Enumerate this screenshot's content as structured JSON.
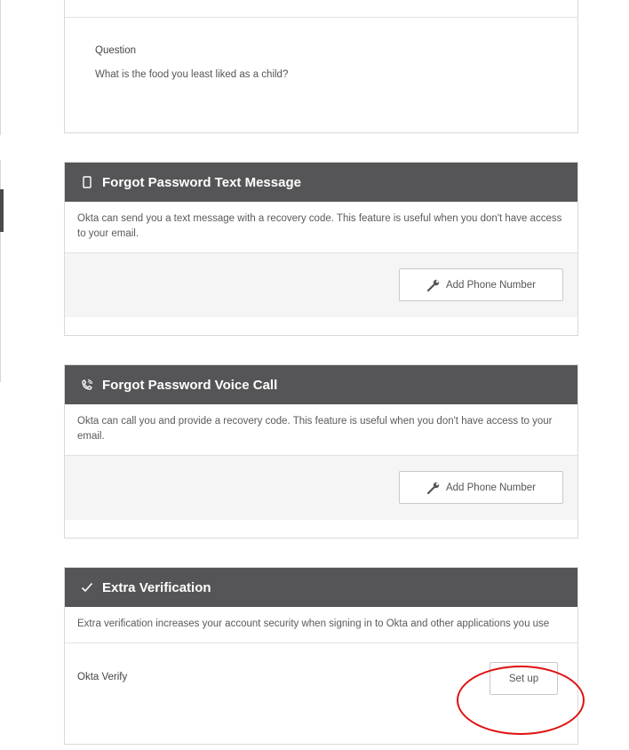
{
  "question_card": {
    "label": "Question",
    "question": "What is the food you least liked as a child?"
  },
  "sms_card": {
    "icon": "mobile-phone-icon",
    "title": "Forgot Password Text Message",
    "description": "Okta can send you a text message with a recovery code. This feature is useful when you don't have access to your email.",
    "button_label": "Add Phone Number"
  },
  "voice_card": {
    "icon": "phone-call-icon",
    "title": "Forgot Password Voice Call",
    "description": "Okta can call you and provide a recovery code. This feature is useful when you don't have access to your email.",
    "button_label": "Add Phone Number"
  },
  "extra_card": {
    "icon": "checkmark-icon",
    "title": "Extra Verification",
    "description": "Extra verification increases your account security when signing in to Okta and other applications you use",
    "factor_label": "Okta Verify",
    "button_label": "Set up"
  },
  "colors": {
    "header_bg": "#555557",
    "annotation": "#e01010"
  }
}
